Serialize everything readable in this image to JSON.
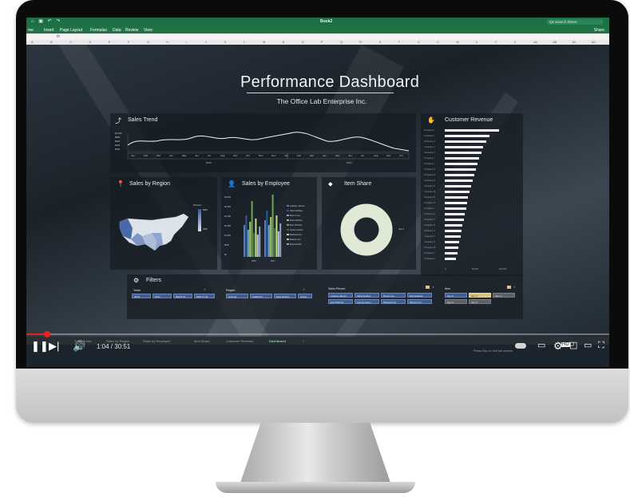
{
  "excel": {
    "book_title": "Book2",
    "search_placeholder": "Q▾ Search Sheet",
    "quick_access": "⌂ ▣ ↶ ↷",
    "menu": [
      "me",
      "Insert",
      "Page Layout",
      "Formulas",
      "Data",
      "Review",
      "View"
    ],
    "share": "Share",
    "fx": "fx",
    "columns": [
      "A",
      "B",
      "C",
      "D",
      "E",
      "F",
      "G",
      "H",
      "I",
      "J",
      "K",
      "L",
      "M",
      "N",
      "O",
      "P",
      "Q",
      "R",
      "S",
      "T",
      "U",
      "V",
      "W",
      "X",
      "Y",
      "Z",
      "AA",
      "AB",
      "AC",
      "AD"
    ]
  },
  "dashboard": {
    "title": "Performance Dashboard",
    "subtitle": "The Office Lab Enterprise Inc.",
    "sales_trend": {
      "title": "Sales Trend",
      "months": [
        "Jan",
        "Feb",
        "Mar",
        "Apr",
        "May",
        "Jun",
        "Jul",
        "Aug",
        "Sep",
        "Oct",
        "Nov",
        "Dec",
        "Jan",
        "Feb",
        "Mar",
        "Apr",
        "May",
        "Jun",
        "Jul",
        "Aug",
        "Sep",
        "Oct"
      ],
      "years": [
        "2016",
        "2017"
      ]
    },
    "customer_revenue": {
      "title": "Customer Revenue",
      "companies": [
        "Company A",
        "Company J",
        "Company C",
        "Company F",
        "Company V",
        "Company Y",
        "Company L",
        "Company G",
        "Company D",
        "Company H",
        "Company K",
        "Company M",
        "Company B",
        "Company N",
        "Company I",
        "Company O",
        "Company P",
        "Company R",
        "Company S",
        "Company T",
        "Company U",
        "Company W",
        "Company X",
        "Company Z"
      ],
      "values": [
        100,
        82,
        77,
        71,
        68,
        63,
        60,
        57,
        54,
        51,
        48,
        45,
        43,
        41,
        39,
        37,
        35,
        33,
        31,
        29,
        27,
        25,
        23,
        21
      ],
      "axis": [
        "0",
        "$5,000",
        "$10,000"
      ]
    },
    "sales_by_region": {
      "title": "Sales by Region",
      "legend_title": "Revenue",
      "legend_values": [
        "$86K",
        "$32K"
      ]
    },
    "sales_by_employee": {
      "title": "Sales by Employee",
      "y_ticks": [
        "$3,000",
        "$2,500",
        "$2,000",
        "$1,500",
        "$1,000",
        "$500",
        "$0"
      ],
      "x_ticks": [
        "2016",
        "2017"
      ],
      "legend": [
        "Andrew James",
        "Alicia Robles",
        "Bruno Lee",
        "Neil Hollows",
        "Erin Pittman",
        "Laura Larsen",
        "Michael Fox",
        "Maxine Lin",
        "Rose Fisher"
      ],
      "colors": [
        "#4f7fbf",
        "#2d5a8c",
        "#7fa3d6",
        "#9ecb63",
        "#6aa84f",
        "#3e6b35",
        "#c7d98f",
        "#b9c7d5",
        "#8fa8bd"
      ]
    },
    "item_share": {
      "title": "Item Share",
      "label": "Item 1",
      "color": "#dfe9d5"
    },
    "filters": {
      "title": "Filters",
      "years_label": "Years",
      "years": [
        "2016",
        "2017",
        "RECZ 16",
        "SEP 17 16"
      ],
      "region_label": "Region",
      "regions": [
        "Arizona",
        "California",
        "New Mexico",
        "Texas"
      ],
      "salesperson_label": "Sales Person",
      "salespeople": [
        "Andrew James",
        "Alicia Robles",
        "Bruno Lee",
        "Neil Hollows",
        "Erin Pittman",
        "Laura Larsen",
        "Michael Fox",
        "Maxine Lin"
      ],
      "item_label": "Item",
      "items": [
        "Item 1",
        "Item 2",
        "Item 3",
        "Item 4",
        "Item 5"
      ]
    }
  },
  "sheet_tabs": [
    "Sales Trend",
    "Sales by Region",
    "Sales by Employee",
    "Item Share",
    "Customer Revenue",
    "Dashboard",
    "+"
  ],
  "video": {
    "timecode": "1:04 / 30:51",
    "progress_fraction": 0.035,
    "hint": "Press Esc to exit full screen",
    "hd": "HD"
  }
}
